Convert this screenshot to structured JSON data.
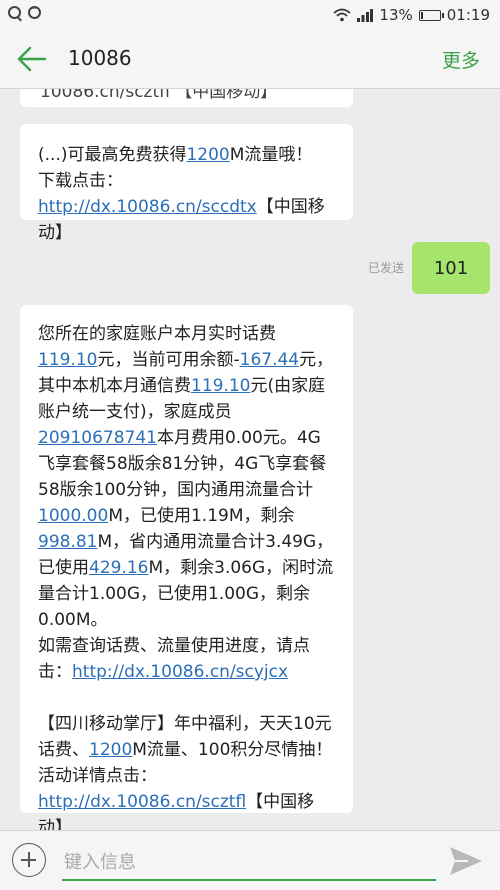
{
  "status_bar": {
    "battery_percent": "13%",
    "battery_level": 0.13,
    "time": "01:19"
  },
  "header": {
    "title": "10086",
    "more_label": "更多"
  },
  "messages": {
    "partial_top": "10086.cn/scztfl 【中国移动】",
    "m1": {
      "prefix": "(...)可最高免费获得",
      "num": "1200",
      "mid": "M流量哦！",
      "download": "下载点击：",
      "link": "http://dx.10086.cn/sccdtx",
      "suffix": "【中国移动】"
    },
    "sent": {
      "text": "101",
      "status": "已发送"
    },
    "m2": {
      "t1": "您所在的家庭账户本月实时话费",
      "n1": "119.10",
      "t2": "元，当前可用余额-",
      "n2": "167.44",
      "t3": "元，其中本机本月通信费",
      "n3": "119.10",
      "t4": "元(由家庭账户统一支付)，家庭成员",
      "n4": "20910678741",
      "t5": "本月费用0.00元。4G飞享套餐58版余81分钟，4G飞享套餐58版余100分钟，国内通用流量合计",
      "n5": "1000.00",
      "t6": "M，已使用1.19M，剩余",
      "n6": "998.81",
      "t7": "M，省内通用流量合计3.49G，已使用",
      "n7": "429.16",
      "t8": "M，剩余3.06G，闲时流量合计1.00G，已使用1.00G，剩余0.00M。",
      "t9": "如需查询话费、流量使用进度，请点击：",
      "link1": "http://dx.10086.cn/scyjcx",
      "t10": "【四川移动掌厅】年中福利，天天10元话费、",
      "n8": "1200",
      "t11": "M流量、100积分尽情抽！活动详情点击：",
      "link2": "http://dx.10086.cn/scztfl",
      "t12": "【中国移动】"
    }
  },
  "input": {
    "placeholder": "键入信息"
  }
}
